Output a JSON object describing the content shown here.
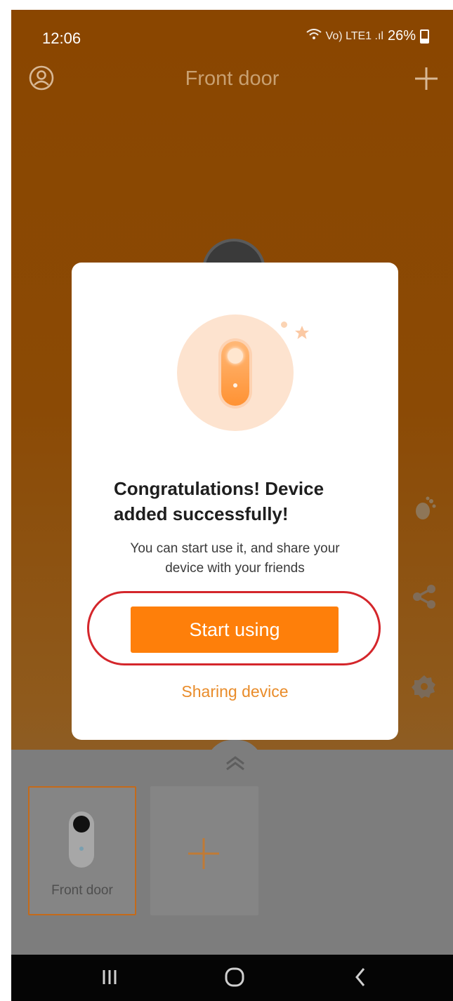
{
  "status_bar": {
    "time": "12:06",
    "signal_text": "Vo) LTE1 .ıl",
    "battery": "26%"
  },
  "header": {
    "title": "Front door"
  },
  "modal": {
    "title": "Congratulations! Device added successfully!",
    "message": "You can start use it, and share your device with your friends",
    "primary_button": "Start using",
    "secondary_link": "Sharing device"
  },
  "device_list": {
    "items": [
      {
        "name": "Front door",
        "selected": true
      }
    ]
  },
  "icons": {
    "account": "account-icon",
    "add": "plus-icon",
    "motion": "footprint-icon",
    "share": "share-icon",
    "settings": "gear-icon",
    "expand": "chevron-up-icon",
    "nav_recent": "recents-icon",
    "nav_home": "home-icon",
    "nav_back": "back-icon"
  },
  "colors": {
    "accent": "#fe7f0a",
    "link": "#e98c2a",
    "header_bg": "#8a4600",
    "highlight": "#d4262b"
  }
}
